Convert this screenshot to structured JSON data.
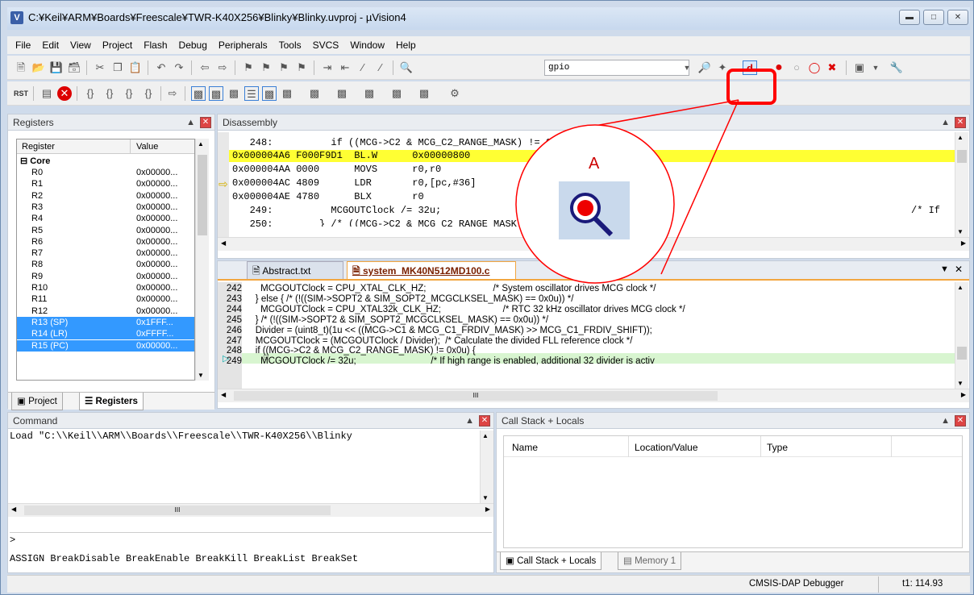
{
  "window": {
    "title": "C:¥Keil¥ARM¥Boards¥Freescale¥TWR-K40X256¥Blinky¥Blinky.uvproj - µVision4",
    "icon": "uv-icon",
    "controls": [
      "minimize",
      "maximize",
      "close"
    ]
  },
  "menu": [
    "File",
    "Edit",
    "View",
    "Project",
    "Flash",
    "Debug",
    "Peripherals",
    "Tools",
    "SVCS",
    "Window",
    "Help"
  ],
  "toolbar": {
    "search_value": "gpio"
  },
  "registers_panel": {
    "title": "Registers",
    "col_register": "Register",
    "col_value": "Value",
    "group": "Core",
    "rows": [
      {
        "name": "R0",
        "value": "0x00000..."
      },
      {
        "name": "R1",
        "value": "0x00000..."
      },
      {
        "name": "R2",
        "value": "0x00000..."
      },
      {
        "name": "R3",
        "value": "0x00000..."
      },
      {
        "name": "R4",
        "value": "0x00000..."
      },
      {
        "name": "R5",
        "value": "0x00000..."
      },
      {
        "name": "R6",
        "value": "0x00000..."
      },
      {
        "name": "R7",
        "value": "0x00000..."
      },
      {
        "name": "R8",
        "value": "0x00000..."
      },
      {
        "name": "R9",
        "value": "0x00000..."
      },
      {
        "name": "R10",
        "value": "0x00000..."
      },
      {
        "name": "R11",
        "value": "0x00000..."
      },
      {
        "name": "R12",
        "value": "0x00000..."
      },
      {
        "name": "R13 (SP)",
        "value": "0x1FFF..."
      },
      {
        "name": "R14 (LR)",
        "value": "0xFFFF..."
      },
      {
        "name": "R15 (PC)",
        "value": "0x00000..."
      }
    ],
    "tab_project": "Project",
    "tab_registers": "Registers"
  },
  "disassembly": {
    "title": "Disassembly",
    "lines": [
      "   248:          if ((MCG->C2 & MCG_C2_RANGE_MASK) != 0x0u) {",
      "0x000004A6 F000F9D1  BL.W      0x00000800",
      "0x000004AA 0000      MOVS      r0,r0",
      "0x000004AC 4809      LDR       r0,[pc,#36]",
      "0x000004AE 4780      BLX       r0",
      "   249:          MCGOUTClock /= 32u;",
      "   250:        } /* ((MCG->C2 & MCG_C2_RANGE_MASK) != 0x0u) */"
    ],
    "line_249_comment": "/* If"
  },
  "editor": {
    "tab1": "Abstract.txt",
    "tab2": "system_MK40N512MD100.c",
    "lines": [
      {
        "num": "242",
        "code": "      MCGOUTClock = CPU_XTAL_CLK_HZ;                          /* System oscillator drives MCG clock */"
      },
      {
        "num": "243",
        "code": "    } else { /* (!((SIM->SOPT2 & SIM_SOPT2_MCGCLKSEL_MASK) == 0x0u)) */"
      },
      {
        "num": "244",
        "code": "      MCGOUTClock = CPU_XTAL32k_CLK_HZ;                        /* RTC 32 kHz oscillator drives MCG clock */"
      },
      {
        "num": "245",
        "code": "    } /* (!((SIM->SOPT2 & SIM_SOPT2_MCGCLKSEL_MASK) == 0x0u)) */"
      },
      {
        "num": "246",
        "code": "    Divider = (uint8_t)(1u << ((MCG->C1 & MCG_C1_FRDIV_MASK) >> MCG_C1_FRDIV_SHIFT));"
      },
      {
        "num": "247",
        "code": "    MCGOUTClock = (MCGOUTClock / Divider);  /* Calculate the divided FLL reference clock */"
      },
      {
        "num": "248",
        "code": "    if ((MCG->C2 & MCG_C2_RANGE_MASK) != 0x0u) {"
      },
      {
        "num": "249",
        "code": "      MCGOUTClock /= 32u;                             /* If high range is enabled, additional 32 divider is activ"
      }
    ],
    "hscroll_mark": "III"
  },
  "command": {
    "title": "Command",
    "output": "Load \"C:\\\\Keil\\\\ARM\\\\Boards\\\\Freescale\\\\TWR-K40X256\\\\Blinky",
    "prompt": ">",
    "hint": "ASSIGN BreakDisable BreakEnable BreakKill BreakList BreakSet",
    "hscroll_mark": "III"
  },
  "callstack": {
    "title": "Call Stack + Locals",
    "col_name": "Name",
    "col_location": "Location/Value",
    "col_type": "Type",
    "tab1": "Call Stack + Locals",
    "tab2": "Memory 1"
  },
  "status": {
    "debugger": "CMSIS-DAP Debugger",
    "time": "t1: 114.93"
  },
  "callout": {
    "label": "A"
  },
  "colors": {
    "highlight": "#ffff33",
    "selection": "#3399ff",
    "callout": "#ff0000"
  }
}
